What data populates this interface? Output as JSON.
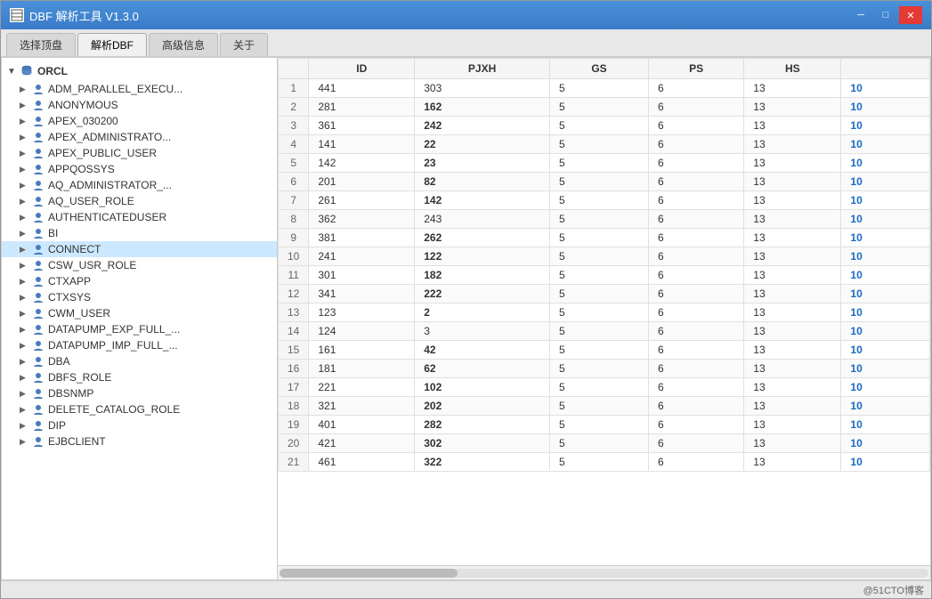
{
  "window": {
    "title": "DBF 解析工具 V1.3.0",
    "min_label": "─",
    "restore_label": "□",
    "close_label": "✕"
  },
  "tabs": [
    {
      "label": "选择顶盘",
      "active": false
    },
    {
      "label": "解析DBF",
      "active": true
    },
    {
      "label": "高级信息",
      "active": false
    },
    {
      "label": "关于",
      "active": false
    }
  ],
  "tree": {
    "root": "ORCL",
    "items": [
      "ADM_PARALLEL_EXECU...",
      "ANONYMOUS",
      "APEX_030200",
      "APEX_ADMINISTRATO...",
      "APEX_PUBLIC_USER",
      "APPQOSSYS",
      "AQ_ADMINISTRATOR_...",
      "AQ_USER_ROLE",
      "AUTHENTICATEDUSER",
      "BI",
      "CONNECT",
      "CSW_USR_ROLE",
      "CTXAPP",
      "CTXSYS",
      "CWM_USER",
      "DATAPUMP_EXP_FULL_...",
      "DATAPUMP_IMP_FULL_...",
      "DBA",
      "DBFS_ROLE",
      "DBSNMP",
      "DELETE_CATALOG_ROLE",
      "DIP",
      "EJBCLIENT"
    ]
  },
  "table": {
    "columns": [
      "",
      "ID",
      "PJXH",
      "GS",
      "PS",
      "HS"
    ],
    "rows": [
      {
        "row_num": 1,
        "id": "441",
        "pjxh": "303",
        "gs": "5",
        "ps": "6",
        "hs": "13",
        "extra": "10"
      },
      {
        "row_num": 2,
        "id": "281",
        "pjxh": "162",
        "gs": "5",
        "ps": "6",
        "hs": "13",
        "extra": "10"
      },
      {
        "row_num": 3,
        "id": "361",
        "pjxh": "242",
        "gs": "5",
        "ps": "6",
        "hs": "13",
        "extra": "10"
      },
      {
        "row_num": 4,
        "id": "141",
        "pjxh": "22",
        "gs": "5",
        "ps": "6",
        "hs": "13",
        "extra": "10"
      },
      {
        "row_num": 5,
        "id": "142",
        "pjxh": "23",
        "gs": "5",
        "ps": "6",
        "hs": "13",
        "extra": "10"
      },
      {
        "row_num": 6,
        "id": "201",
        "pjxh": "82",
        "gs": "5",
        "ps": "6",
        "hs": "13",
        "extra": "10"
      },
      {
        "row_num": 7,
        "id": "261",
        "pjxh": "142",
        "gs": "5",
        "ps": "6",
        "hs": "13",
        "extra": "10"
      },
      {
        "row_num": 8,
        "id": "362",
        "pjxh": "243",
        "gs": "5",
        "ps": "6",
        "hs": "13",
        "extra": "10"
      },
      {
        "row_num": 9,
        "id": "381",
        "pjxh": "262",
        "gs": "5",
        "ps": "6",
        "hs": "13",
        "extra": "10"
      },
      {
        "row_num": 10,
        "id": "241",
        "pjxh": "122",
        "gs": "5",
        "ps": "6",
        "hs": "13",
        "extra": "10"
      },
      {
        "row_num": 11,
        "id": "301",
        "pjxh": "182",
        "gs": "5",
        "ps": "6",
        "hs": "13",
        "extra": "10"
      },
      {
        "row_num": 12,
        "id": "341",
        "pjxh": "222",
        "gs": "5",
        "ps": "6",
        "hs": "13",
        "extra": "10"
      },
      {
        "row_num": 13,
        "id": "123",
        "pjxh": "2",
        "gs": "5",
        "ps": "6",
        "hs": "13",
        "extra": "10"
      },
      {
        "row_num": 14,
        "id": "124",
        "pjxh": "3",
        "gs": "5",
        "ps": "6",
        "hs": "13",
        "extra": "10"
      },
      {
        "row_num": 15,
        "id": "161",
        "pjxh": "42",
        "gs": "5",
        "ps": "6",
        "hs": "13",
        "extra": "10"
      },
      {
        "row_num": 16,
        "id": "181",
        "pjxh": "62",
        "gs": "5",
        "ps": "6",
        "hs": "13",
        "extra": "10"
      },
      {
        "row_num": 17,
        "id": "221",
        "pjxh": "102",
        "gs": "5",
        "ps": "6",
        "hs": "13",
        "extra": "10"
      },
      {
        "row_num": 18,
        "id": "321",
        "pjxh": "202",
        "gs": "5",
        "ps": "6",
        "hs": "13",
        "extra": "10"
      },
      {
        "row_num": 19,
        "id": "401",
        "pjxh": "282",
        "gs": "5",
        "ps": "6",
        "hs": "13",
        "extra": "10"
      },
      {
        "row_num": 20,
        "id": "421",
        "pjxh": "302",
        "gs": "5",
        "ps": "6",
        "hs": "13",
        "extra": "10"
      },
      {
        "row_num": 21,
        "id": "461",
        "pjxh": "322",
        "gs": "5",
        "ps": "6",
        "hs": "13",
        "extra": "10"
      }
    ]
  },
  "footer": {
    "watermark": "@51CTO博客"
  }
}
